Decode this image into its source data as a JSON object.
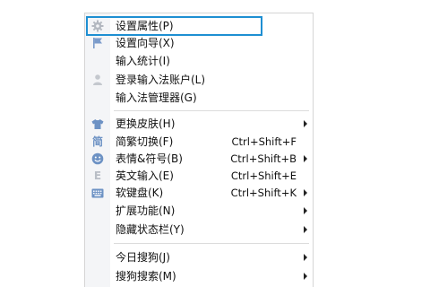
{
  "menu": {
    "group1": [
      {
        "label": "设置属性(P)",
        "icon": "gear-icon"
      },
      {
        "label": "设置向导(X)",
        "icon": "flag-icon"
      },
      {
        "label": "输入统计(I)",
        "icon": ""
      },
      {
        "label": "登录输入法账户(L)",
        "icon": "user-icon"
      },
      {
        "label": "输入法管理器(G)",
        "icon": ""
      }
    ],
    "group2": [
      {
        "label": "更换皮肤(H)",
        "icon": "tshirt-icon",
        "shortcut": "",
        "submenu": true
      },
      {
        "label": "简繁切换(F)",
        "icon": "simplified-char-icon",
        "icon_glyph": "简",
        "shortcut": "Ctrl+Shift+F",
        "submenu": false
      },
      {
        "label": "表情&符号(B)",
        "icon": "smiley-icon",
        "shortcut": "Ctrl+Shift+B",
        "submenu": true
      },
      {
        "label": "英文输入(E)",
        "icon": "letter-e-icon",
        "icon_glyph": "E",
        "shortcut": "Ctrl+Shift+E",
        "submenu": false
      },
      {
        "label": "软键盘(K)",
        "icon": "keyboard-icon",
        "shortcut": "Ctrl+Shift+K",
        "submenu": true
      },
      {
        "label": "扩展功能(N)",
        "icon": "",
        "shortcut": "",
        "submenu": true
      },
      {
        "label": "隐藏状态栏(Y)",
        "icon": "",
        "shortcut": "",
        "submenu": true
      }
    ],
    "group3": [
      {
        "label": "今日搜狗(J)",
        "icon": "",
        "submenu": true
      },
      {
        "label": "搜狗搜索(M)",
        "icon": "",
        "submenu": true
      }
    ]
  },
  "colors": {
    "highlight_border": "#1e8fd2",
    "icon_blue": "#6d92c4",
    "icon_gray": "#b9bec6"
  }
}
